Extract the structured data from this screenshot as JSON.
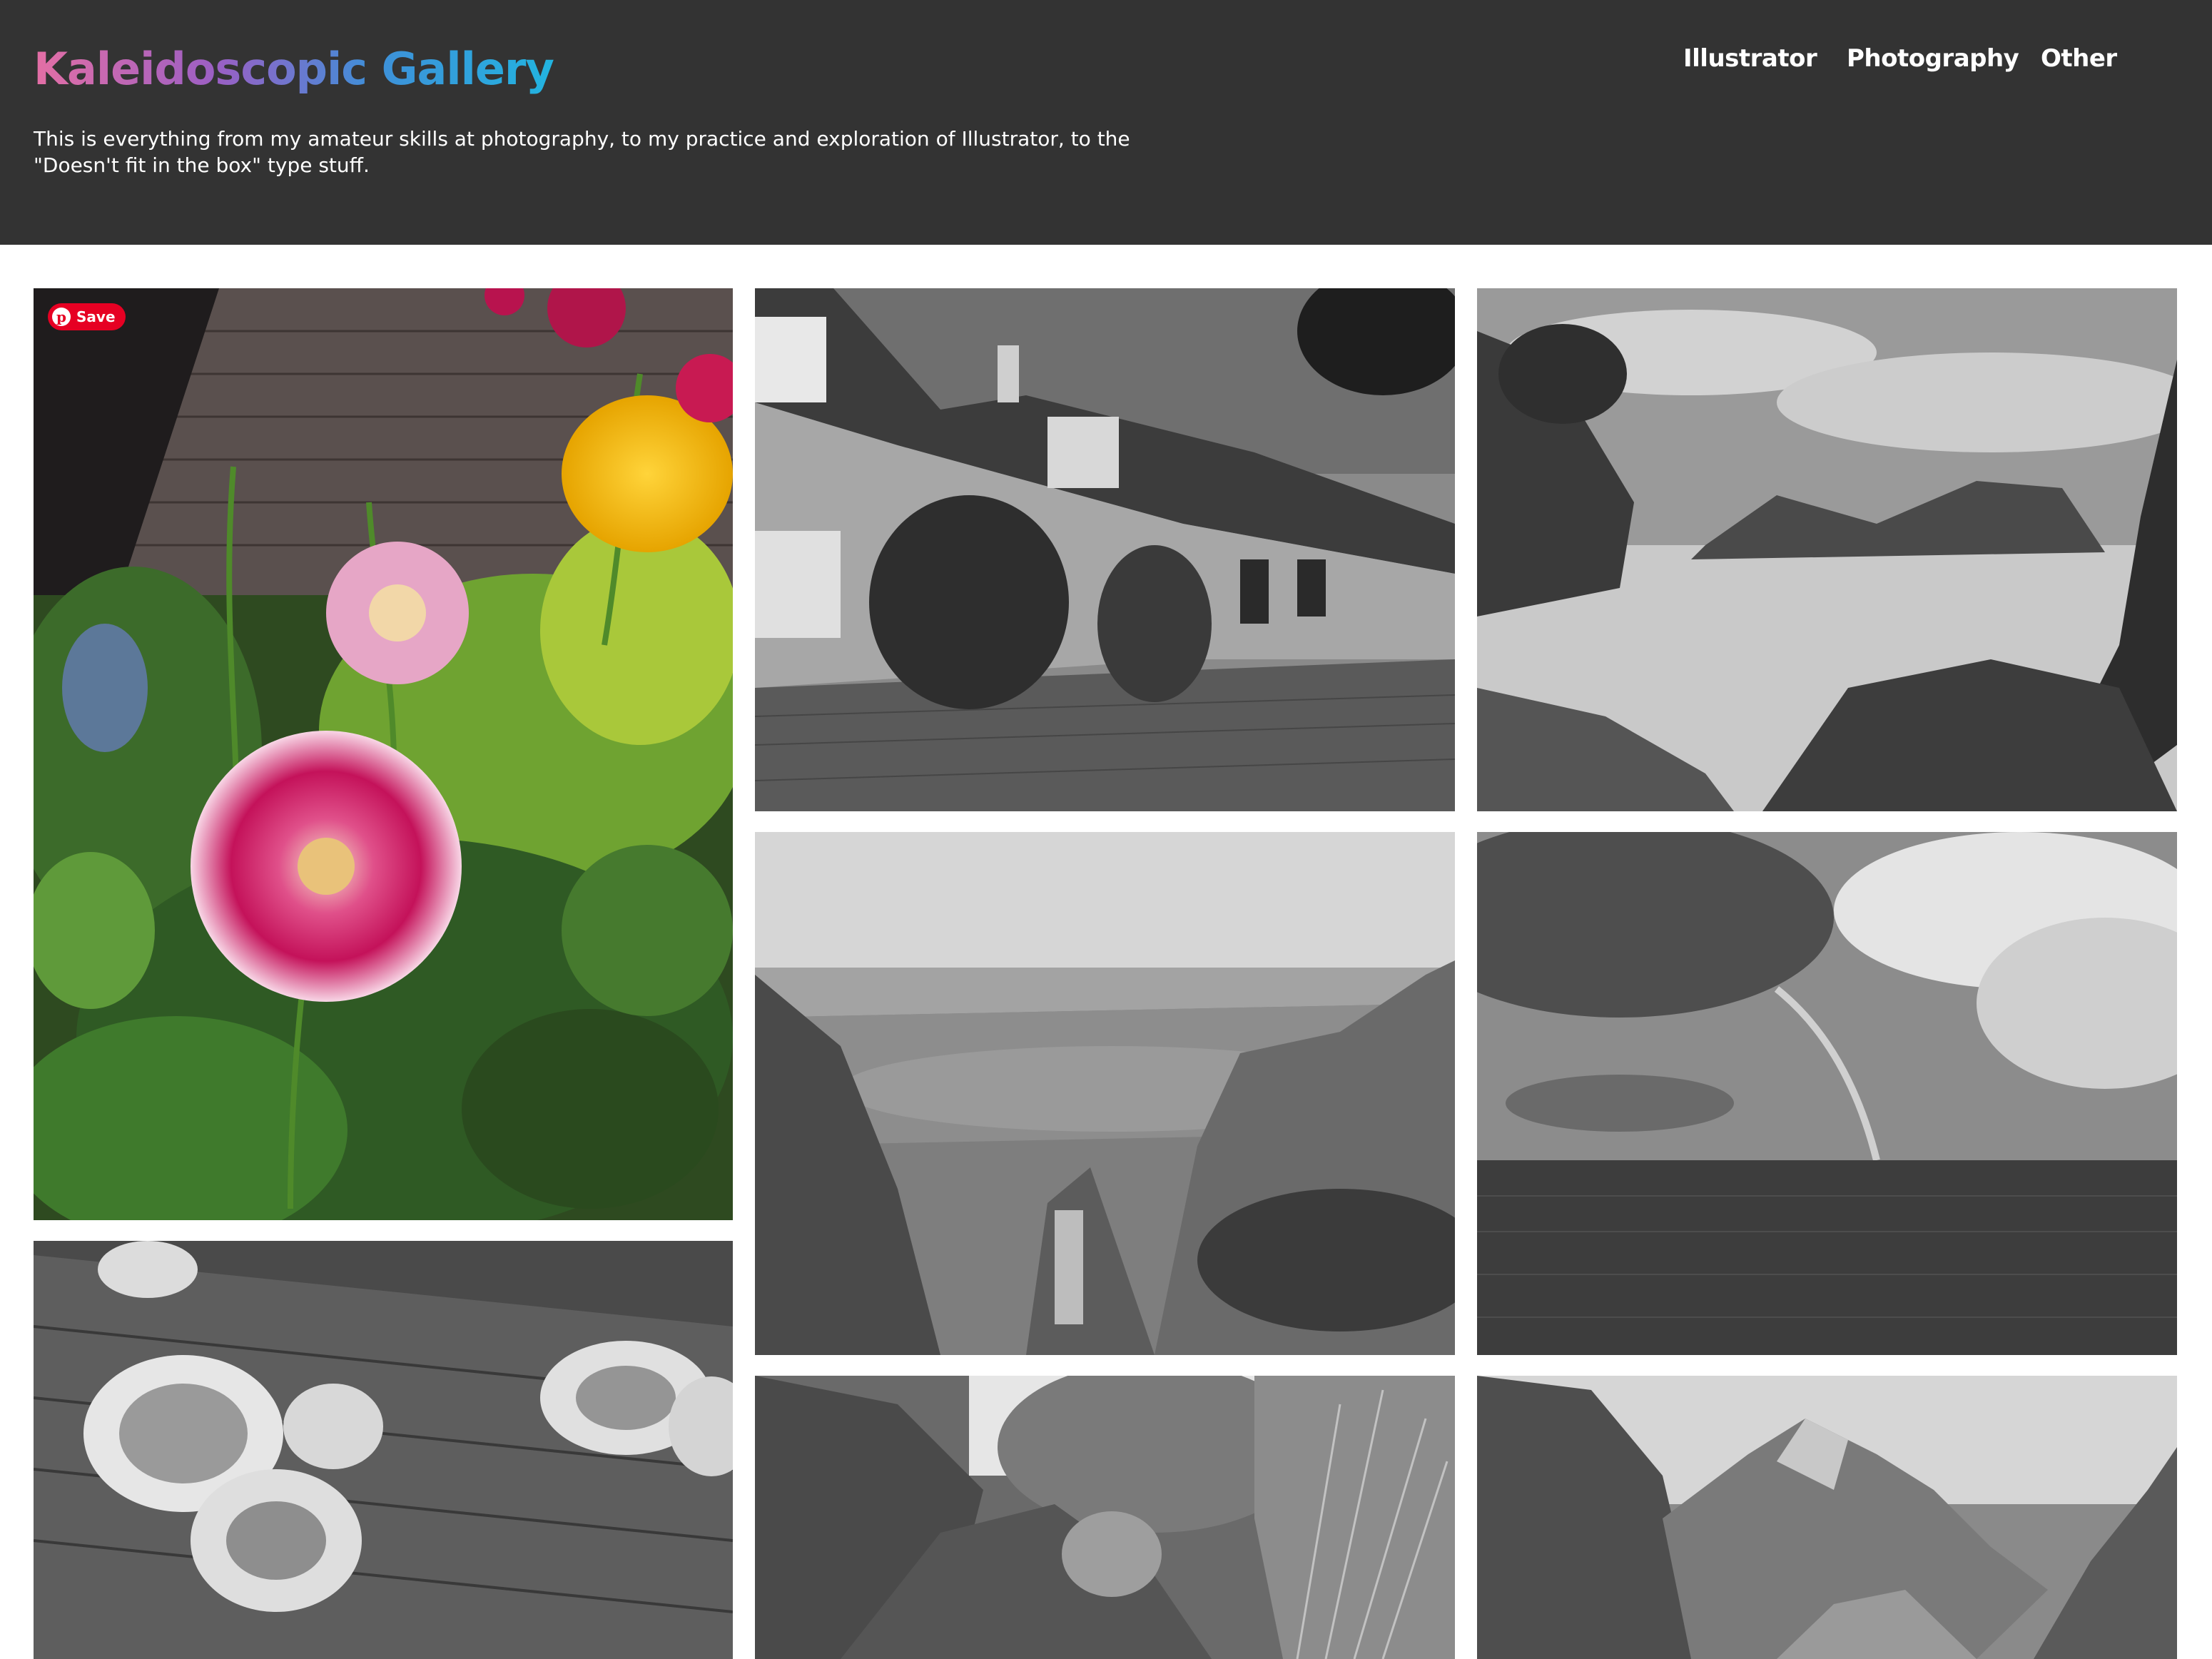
{
  "site": {
    "title": "Kaleidoscopic Gallery",
    "tagline": "This is everything from my amateur skills at photography, to my practice and exploration of Illustrator, to the \"Doesn't fit in the box\" type stuff."
  },
  "nav": {
    "items": [
      {
        "label": "Illustrator"
      },
      {
        "label": "Photography"
      },
      {
        "label": "Other"
      }
    ]
  },
  "pin_button": {
    "label": "Save",
    "icon": "pinterest-icon"
  },
  "colors": {
    "header_bg": "#333333",
    "title_gradient": [
      "#e46fa5",
      "#9b5fc4",
      "#3f8fd8",
      "#22b4e0"
    ],
    "pin_red": "#e60023"
  },
  "gallery": {
    "photos": [
      {
        "subject": "dahlia-flowers"
      },
      {
        "subject": "cottage-street"
      },
      {
        "subject": "rocky-coastline"
      },
      {
        "subject": "canyon"
      },
      {
        "subject": "ocean-rainbow"
      },
      {
        "subject": "fungus-on-log"
      },
      {
        "subject": "rocky-forest"
      },
      {
        "subject": "mountain-valley"
      }
    ]
  }
}
